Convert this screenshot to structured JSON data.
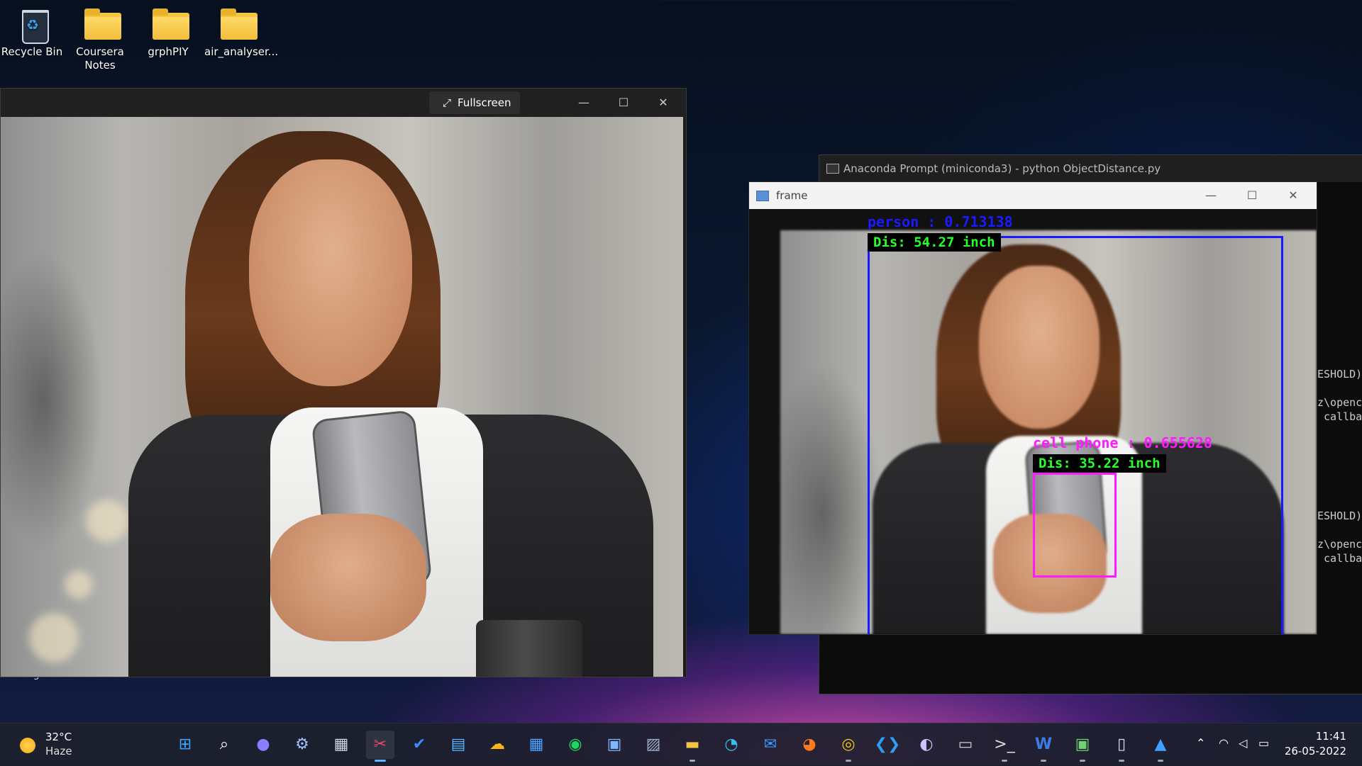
{
  "desktop": {
    "icons": [
      {
        "label": "Recycle Bin"
      },
      {
        "label": "Coursera Notes"
      },
      {
        "label": "grphPIY"
      },
      {
        "label": "air_analyser..."
      }
    ],
    "partial_text": "College ID"
  },
  "photo_window": {
    "fullscreen_label": "Fullscreen",
    "minimize": "—",
    "maximize": "☐",
    "close": "✕"
  },
  "terminal": {
    "title": "Anaconda Prompt (miniconda3) - python  ObjectDistance.py",
    "lines": [
      "ESHOLD)",
      "z\\openc",
      " callba",
      "ESHOLD)",
      "z\\openc",
      " callba"
    ]
  },
  "frame_window": {
    "title": "frame",
    "person_label": "person : 0.713138",
    "person_distance": "Dis: 54.27 inch",
    "phone_label": "cell phone : 0.655628",
    "phone_distance": "Dis: 35.22 inch",
    "person_color": "#1a1aff",
    "phone_color": "#ff1aff",
    "distance_color": "#28ff28"
  },
  "taskbar": {
    "weather": {
      "temp": "32°C",
      "condition": "Haze"
    },
    "icons": [
      "start-icon",
      "search-icon",
      "chat-icon",
      "settings-icon",
      "calculator-icon",
      "snipping-tool-icon",
      "todo-icon",
      "notepad-icon",
      "weather-app-icon",
      "calendar-icon",
      "spotify-icon",
      "control-panel-icon",
      "photos-icon",
      "file-explorer-icon",
      "edge-icon",
      "mail-icon",
      "firefox-icon",
      "chrome-icon",
      "vscode-icon",
      "eclipse-icon",
      "terminal-icon",
      "powershell-icon",
      "word-icon",
      "android-studio-icon",
      "app-window-icon",
      "photos-viewer-icon"
    ],
    "clock": {
      "time": "11:41",
      "date": "26-05-2022"
    }
  }
}
